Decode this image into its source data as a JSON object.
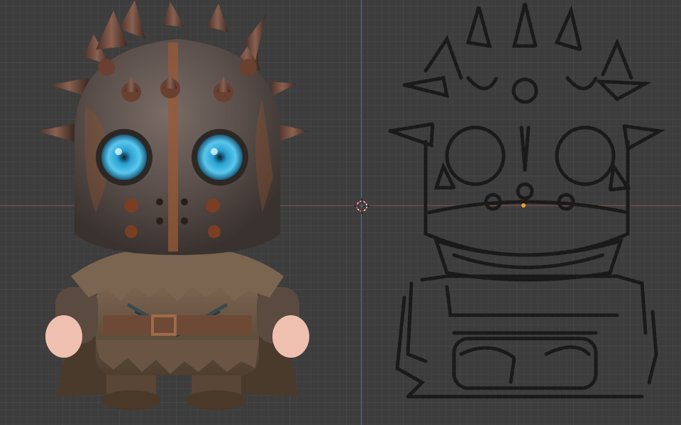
{
  "viewport": {
    "name": "3D Viewport",
    "grid": "visible",
    "axes": [
      "x-axis-red",
      "y-axis-blue"
    ],
    "colors": {
      "background": "#3d3d3d",
      "grid_major": "#474747",
      "x_axis": "#8a4a4a",
      "y_axis": "#4a6f9a",
      "origin": "#f0a030"
    }
  },
  "objects": [
    {
      "name": "spiked-helmet-knight",
      "kind": "rendered-mesh"
    },
    {
      "name": "grease-pencil-outline",
      "kind": "stroke-drawing"
    }
  ],
  "icons": {
    "cursor": "3d-cursor-icon",
    "origin": "object-origin-icon"
  }
}
